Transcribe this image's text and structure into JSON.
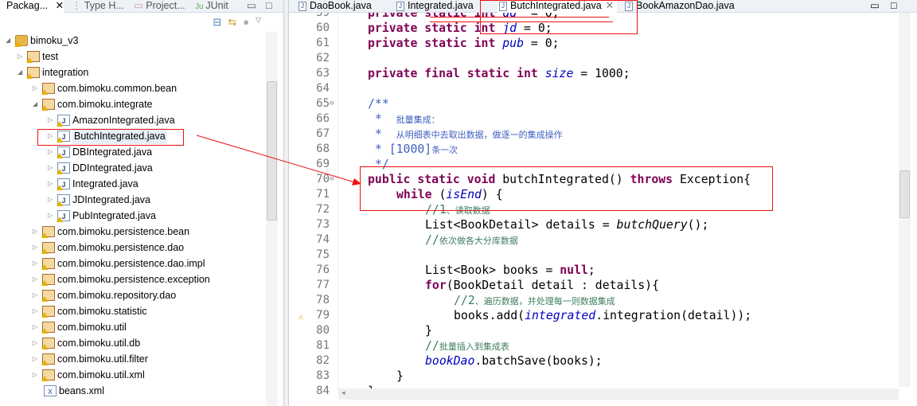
{
  "left_panel": {
    "tabs": [
      {
        "label": "Packag...",
        "active": true
      },
      {
        "label": "Type H..."
      },
      {
        "label": "Project..."
      },
      {
        "label": "JUnit"
      }
    ],
    "toolbar": [
      "collapse-all-icon",
      "link-with-editor-icon",
      "view-menu-icon"
    ],
    "tree": [
      {
        "label": "bimoku_v3",
        "type": "project",
        "level": 0,
        "expanded": true
      },
      {
        "label": "test",
        "type": "source-folder",
        "level": 1,
        "expanded": false
      },
      {
        "label": "integration",
        "type": "source-folder",
        "level": 1,
        "expanded": true
      },
      {
        "label": "com.bimoku.common.bean",
        "type": "package",
        "level": 2,
        "expanded": false
      },
      {
        "label": "com.bimoku.integrate",
        "type": "package",
        "level": 2,
        "expanded": true
      },
      {
        "label": "AmazonIntegrated.java",
        "type": "java",
        "level": 3
      },
      {
        "label": "ButchIntegrated.java",
        "type": "java",
        "level": 3,
        "selected": true
      },
      {
        "label": "DBIntegrated.java",
        "type": "java",
        "level": 3
      },
      {
        "label": "DDIntegrated.java",
        "type": "java",
        "level": 3
      },
      {
        "label": "Integrated.java",
        "type": "java",
        "level": 3
      },
      {
        "label": "JDIntegrated.java",
        "type": "java",
        "level": 3
      },
      {
        "label": "PubIntegrated.java",
        "type": "java",
        "level": 3
      },
      {
        "label": "com.bimoku.persistence.bean",
        "type": "package",
        "level": 2,
        "expanded": false
      },
      {
        "label": "com.bimoku.persistence.dao",
        "type": "package",
        "level": 2,
        "expanded": false
      },
      {
        "label": "com.bimoku.persistence.dao.impl",
        "type": "package",
        "level": 2,
        "expanded": false
      },
      {
        "label": "com.bimoku.persistence.exception",
        "type": "package",
        "level": 2,
        "expanded": false
      },
      {
        "label": "com.bimoku.repository.dao",
        "type": "package",
        "level": 2,
        "expanded": false
      },
      {
        "label": "com.bimoku.statistic",
        "type": "package",
        "level": 2,
        "expanded": false
      },
      {
        "label": "com.bimoku.util",
        "type": "package",
        "level": 2,
        "expanded": false
      },
      {
        "label": "com.bimoku.util.db",
        "type": "package",
        "level": 2,
        "expanded": false
      },
      {
        "label": "com.bimoku.util.filter",
        "type": "package",
        "level": 2,
        "expanded": false
      },
      {
        "label": "com.bimoku.util.xml",
        "type": "package",
        "level": 2,
        "expanded": false
      },
      {
        "label": "beans.xml",
        "type": "xml",
        "level": 2
      }
    ]
  },
  "editor": {
    "tabs": [
      {
        "label": "DaoBook.java"
      },
      {
        "label": "Integrated.java"
      },
      {
        "label": "ButchIntegrated.java",
        "active": true
      },
      {
        "label": "BookAmazonDao.java"
      }
    ],
    "lines": [
      {
        "n": "59",
        "t": [
          [
            "kw",
            "private static int "
          ],
          [
            "fd",
            "dd"
          ],
          [
            "",
            "  = 0;"
          ]
        ],
        "i": 4
      },
      {
        "n": "60",
        "t": [
          [
            "kw",
            "private static int "
          ],
          [
            "fd",
            "jd"
          ],
          [
            "",
            " = 0;"
          ]
        ],
        "i": 4
      },
      {
        "n": "61",
        "t": [
          [
            "kw",
            "private static int "
          ],
          [
            "fd",
            "pub"
          ],
          [
            "",
            " = 0;"
          ]
        ],
        "i": 4
      },
      {
        "n": "62",
        "t": [],
        "i": 0
      },
      {
        "n": "63",
        "t": [
          [
            "kw",
            "private final static int "
          ],
          [
            "fd",
            "size"
          ],
          [
            "",
            " = 1000;"
          ]
        ],
        "i": 4
      },
      {
        "n": "64",
        "t": [],
        "i": 0
      },
      {
        "n": "65",
        "t": [
          [
            "jd",
            "/**"
          ]
        ],
        "i": 4,
        "fold": true
      },
      {
        "n": "66",
        "t": [
          [
            "jd",
            " *  "
          ],
          [
            "jd cjk",
            "批量集成："
          ]
        ],
        "i": 4
      },
      {
        "n": "67",
        "t": [
          [
            "jd",
            " *  "
          ],
          [
            "jd cjk",
            "从明细表中去取出数据，做逐一的集成操作"
          ]
        ],
        "i": 4
      },
      {
        "n": "68",
        "t": [
          [
            "jd",
            " * [1000]"
          ],
          [
            "jd cjk",
            "条一次"
          ]
        ],
        "i": 4
      },
      {
        "n": "69",
        "t": [
          [
            "jd",
            " */"
          ]
        ],
        "i": 4
      },
      {
        "n": "70",
        "t": [
          [
            "kw",
            "public static void "
          ],
          [
            "",
            "butchIntegrated() "
          ],
          [
            "kw",
            "throws "
          ],
          [
            "",
            "Exception{"
          ]
        ],
        "i": 4,
        "fold": true
      },
      {
        "n": "71",
        "t": [
          [
            "kw",
            "while "
          ],
          [
            "",
            "("
          ],
          [
            "fd",
            "isEnd"
          ],
          [
            "",
            ") {"
          ]
        ],
        "i": 8
      },
      {
        "n": "72",
        "t": [
          [
            "cm",
            "//1"
          ],
          [
            "cm cjk",
            "、读取数据"
          ]
        ],
        "i": 12
      },
      {
        "n": "73",
        "t": [
          [
            "",
            "List<BookDetail> details = "
          ],
          [
            "sm",
            "butchQuery"
          ],
          [
            "",
            "();"
          ]
        ],
        "i": 12
      },
      {
        "n": "74",
        "t": [
          [
            "cm",
            "//"
          ],
          [
            "cm cjk",
            "依次做各大分库数据"
          ]
        ],
        "i": 12
      },
      {
        "n": "75",
        "t": [],
        "i": 0
      },
      {
        "n": "76",
        "t": [
          [
            "",
            "List<Book> books = "
          ],
          [
            "kw",
            "null"
          ],
          [
            "",
            ";"
          ]
        ],
        "i": 12
      },
      {
        "n": "77",
        "t": [
          [
            "kw",
            "for"
          ],
          [
            "",
            "(BookDetail detail : details){"
          ]
        ],
        "i": 12
      },
      {
        "n": "78",
        "t": [
          [
            "cm",
            "//2"
          ],
          [
            "cm cjk",
            "、遍历数据，并处理每一则数据集成"
          ]
        ],
        "i": 16
      },
      {
        "n": "79",
        "t": [
          [
            "",
            "books.add("
          ],
          [
            "fd",
            "integrated"
          ],
          [
            "",
            ".integration(detail));"
          ]
        ],
        "i": 16,
        "warning": true
      },
      {
        "n": "80",
        "t": [
          [
            "",
            "}"
          ]
        ],
        "i": 12
      },
      {
        "n": "81",
        "t": [
          [
            "cm",
            "//"
          ],
          [
            "cm cjk",
            "批量插入到集成表"
          ]
        ],
        "i": 12
      },
      {
        "n": "82",
        "t": [
          [
            "fd",
            "bookDao"
          ],
          [
            "",
            ".batchSave(books);"
          ]
        ],
        "i": 12
      },
      {
        "n": "83",
        "t": [
          [
            "",
            "}"
          ]
        ],
        "i": 8
      },
      {
        "n": "84",
        "t": [
          [
            "",
            "}"
          ]
        ],
        "i": 4
      }
    ]
  },
  "colors": {
    "annotation": "#ee1111",
    "keyword": "#7f0055",
    "field": "#0000c0",
    "comment": "#3f7f5f",
    "javadoc": "#3f5fbf"
  }
}
